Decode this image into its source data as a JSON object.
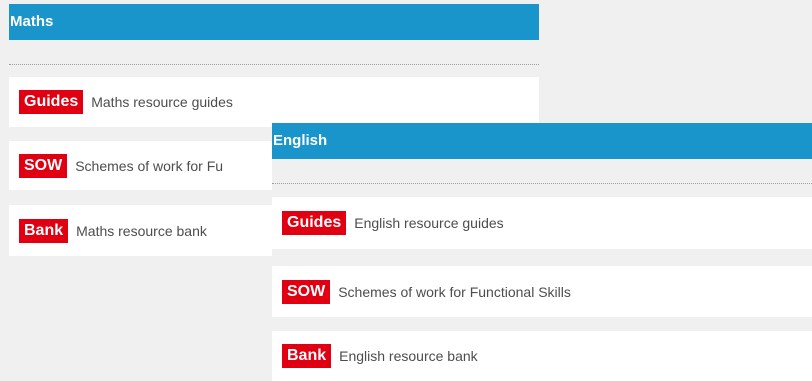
{
  "maths": {
    "title": "Maths",
    "items": [
      {
        "badge": "Guides",
        "label": "Maths resource guides"
      },
      {
        "badge": "SOW",
        "label": "Schemes of work for Fu"
      },
      {
        "badge": "Bank",
        "label": "Maths resource bank"
      }
    ]
  },
  "english": {
    "title": "English",
    "items": [
      {
        "badge": "Guides",
        "label": "English resource guides"
      },
      {
        "badge": "SOW",
        "label": "Schemes of work for Functional Skills"
      },
      {
        "badge": "Bank",
        "label": "English resource bank"
      }
    ]
  },
  "colors": {
    "header_bg": "#1a95cb",
    "badge_bg": "#e10012",
    "page_bg": "#f0f0f0",
    "row_bg": "#ffffff",
    "label_text": "#4d4d4d"
  }
}
